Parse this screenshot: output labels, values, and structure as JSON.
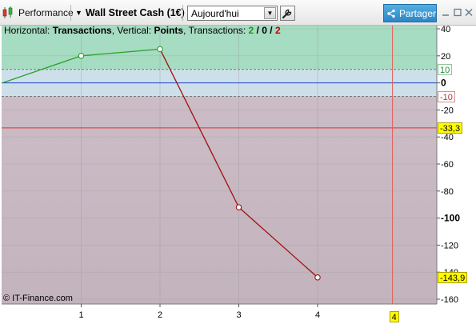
{
  "toolbar": {
    "performance_label": "Performance",
    "instrument_label": "Wall Street Cash (1€)",
    "period_value": "Aujourd'hui",
    "share_label": "Partager"
  },
  "legend": {
    "horizontal_label": "Horizontal:",
    "horizontal_value": "Transactions",
    "vertical_label": "Vertical:",
    "vertical_value": "Points",
    "transactions_label": "Transactions:",
    "win_count": "2",
    "slash1": "/",
    "even_count": "0",
    "slash2": "/",
    "loss_count": "2",
    "win_color": "#1a9c1a",
    "loss_color": "#c00000"
  },
  "watermark": "© IT-Finance.com",
  "tags": {
    "upper_band": "10",
    "lower_band": "-10",
    "reference_level": "-33,3",
    "last_value": "-143,9",
    "cursor_x": "4"
  },
  "colors": {
    "profit_zone": "#a6dcc1",
    "neutral_zone": "#cde0ea",
    "loss_zone": "#c3b3bd",
    "gain_line": "#2aa02a",
    "loss_line": "#a01010",
    "zero_line": "#1c3fc4",
    "reference_line": "#e03030",
    "cursor_line": "#e06060",
    "tag_yellow": "#ffff00"
  },
  "chart_data": {
    "type": "line",
    "x": [
      0,
      1,
      2,
      3,
      4
    ],
    "y": [
      0,
      20,
      25,
      -92,
      -143.9
    ],
    "xlim": [
      0,
      4.5
    ],
    "ylim": [
      -160,
      40
    ],
    "x_ticks": [
      "1",
      "2",
      "3",
      "4"
    ],
    "y_ticks": [
      {
        "value": 40,
        "label": "40",
        "bold": false
      },
      {
        "value": 20,
        "label": "20",
        "bold": false
      },
      {
        "value": 0,
        "label": "0",
        "bold": true
      },
      {
        "value": -20,
        "label": "-20",
        "bold": false
      },
      {
        "value": -40,
        "label": "-40",
        "bold": false
      },
      {
        "value": -60,
        "label": "-60",
        "bold": false
      },
      {
        "value": -80,
        "label": "-80",
        "bold": false
      },
      {
        "value": -100,
        "label": "-100",
        "bold": true
      },
      {
        "value": -120,
        "label": "-120",
        "bold": false
      },
      {
        "value": -140,
        "label": "-140",
        "bold": false
      },
      {
        "value": -160,
        "label": "-160",
        "bold": false
      }
    ],
    "zones": {
      "upper": 10,
      "lower": -10
    },
    "reference_level": -33.3,
    "cursor_x": 4.95
  }
}
